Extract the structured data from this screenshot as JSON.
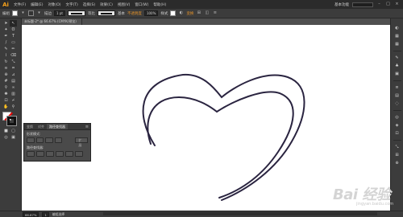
{
  "app": {
    "logo": "Ai"
  },
  "menu": {
    "items": [
      "文件(F)",
      "编辑(E)",
      "对象(O)",
      "文字(T)",
      "选择(S)",
      "效果(C)",
      "视图(V)",
      "窗口(W)",
      "帮助(H)"
    ],
    "workspace": "基本功能",
    "window_controls": [
      "–",
      "□",
      "×"
    ]
  },
  "control_bar": {
    "label": "编组",
    "stroke_label": "描边",
    "stroke_width": "1 pt",
    "profile_label": "等比",
    "brush_label": "基本",
    "opacity_label": "不透明度",
    "opacity_value": "100%",
    "style_label": "样式",
    "transform_label": "变换"
  },
  "document": {
    "tab_title": "未标题-2* @ 66.67% (CMYK/预览)"
  },
  "panel": {
    "tabs": [
      "变换",
      "对齐",
      "路径查找器"
    ],
    "active_tab": "路径查找器",
    "section_shape_modes": "形状模式:",
    "section_pathfinders": "路径查找器:",
    "expand_label": "扩展"
  },
  "status_bar": {
    "zoom": "66.67%",
    "page": "1",
    "tool": "编组选择"
  },
  "watermark": {
    "brand": "Bai 经验",
    "sub": "jingyan.baidu.com"
  },
  "colors": {
    "ai_orange": "#f7a21b",
    "stroke_color": "#2a2440"
  },
  "icons": {
    "tools": [
      "selection-icon",
      "direct-selection-icon",
      "magic-wand-icon",
      "lasso-icon",
      "pen-icon",
      "type-icon",
      "line-icon",
      "rectangle-icon",
      "paintbrush-icon",
      "pencil-icon",
      "blob-brush-icon",
      "eraser-icon",
      "rotate-icon",
      "scale-icon",
      "warp-icon",
      "free-transform-icon",
      "shape-builder-icon",
      "perspective-icon",
      "mesh-icon",
      "gradient-icon",
      "eyedropper-icon",
      "blend-icon",
      "symbol-sprayer-icon",
      "graph-icon",
      "artboard-icon",
      "slice-icon",
      "hand-icon",
      "zoom-icon"
    ]
  }
}
